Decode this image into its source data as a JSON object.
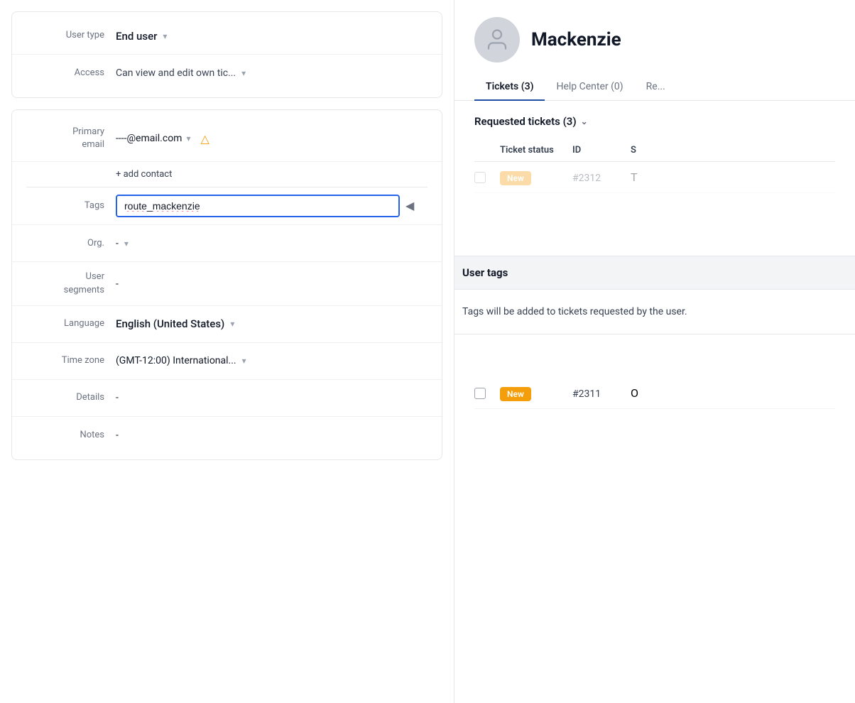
{
  "left": {
    "group1": {
      "user_type_label": "User type",
      "user_type_value": "End user",
      "access_label": "Access",
      "access_value": "Can view and edit own tic..."
    },
    "group2": {
      "primary_email_label": "Primary email",
      "email_value": "----@email.com",
      "add_contact_label": "+ add contact",
      "tags_label": "Tags",
      "tags_input_value": "route_mackenzie",
      "org_label": "Org.",
      "org_value": "-",
      "user_segments_label": "User segments",
      "user_segments_value": "-",
      "language_label": "Language",
      "language_value": "English (United States)",
      "timezone_label": "Time zone",
      "timezone_value": "(GMT-12:00) International...",
      "details_label": "Details",
      "details_value": "-",
      "notes_label": "Notes",
      "notes_value": "-"
    }
  },
  "right": {
    "user_name": "Mackenzie",
    "tabs": [
      {
        "label": "Tickets (3)",
        "active": true
      },
      {
        "label": "Help Center (0)",
        "active": false
      },
      {
        "label": "Re...",
        "active": false
      }
    ],
    "requested_tickets_label": "Requested tickets (3)",
    "table_headers": {
      "status": "Ticket status",
      "id": "ID",
      "subject": "S"
    },
    "tickets": [
      {
        "status": "New",
        "id": "#2312",
        "dimmed": true
      },
      {
        "status": "New",
        "id": "#2311",
        "dimmed": false
      }
    ]
  },
  "popup": {
    "title": "User tags",
    "body": "Tags will be added to tickets requested by the user."
  },
  "icons": {
    "chevron_down": "▾",
    "caret_down": "⌄",
    "warning": "△",
    "collapse": "◀"
  }
}
